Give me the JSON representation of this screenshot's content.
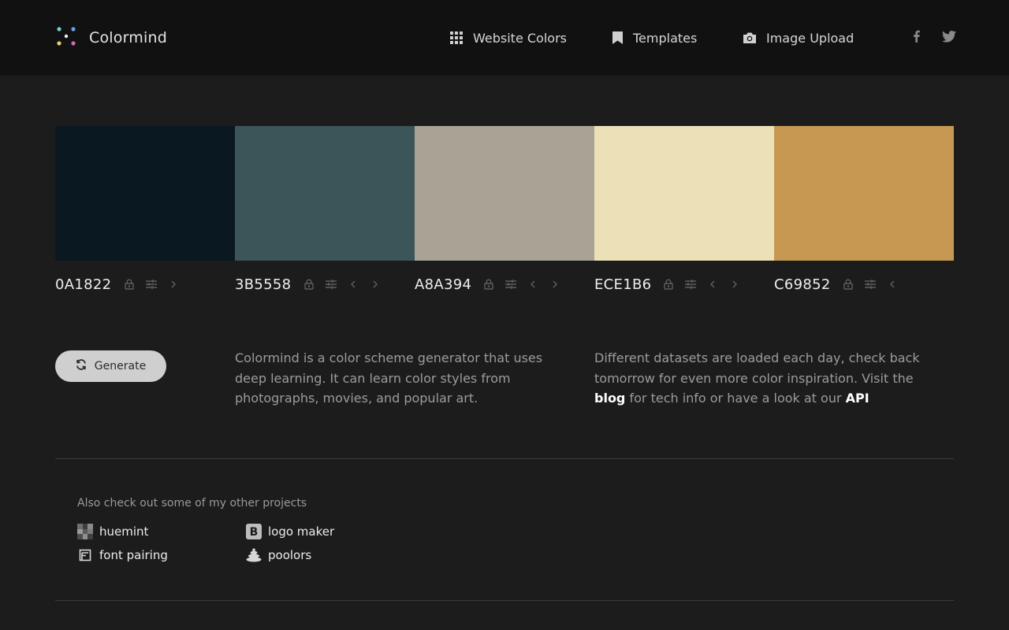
{
  "header": {
    "brand": "Colormind",
    "nav": [
      {
        "label": "Website Colors",
        "icon": "grid-icon"
      },
      {
        "label": "Templates",
        "icon": "bookmark-icon"
      },
      {
        "label": "Image Upload",
        "icon": "camera-icon"
      }
    ],
    "social": [
      "facebook-icon",
      "twitter-icon"
    ]
  },
  "palette": [
    {
      "hex": "0A1822",
      "color": "#0A1822"
    },
    {
      "hex": "3B5558",
      "color": "#3B5558"
    },
    {
      "hex": "A8A394",
      "color": "#A8A394"
    },
    {
      "hex": "ECE1B6",
      "color": "#ECE1B6"
    },
    {
      "hex": "C69852",
      "color": "#C69852"
    }
  ],
  "generate": {
    "label": "Generate"
  },
  "description": {
    "left": "Colormind is a color scheme generator that uses deep learning. It can learn color styles from photographs, movies, and popular art.",
    "right_part1": "Different datasets are loaded each day, check back tomorrow for even more color inspiration. Visit the",
    "right_link1": "blog",
    "right_part2": "for tech info or have a look at our",
    "right_link2": "API"
  },
  "projects": {
    "title": "Also check out some of my other projects",
    "items": [
      {
        "label": "huemint"
      },
      {
        "label": "logo maker"
      },
      {
        "label": "font pairing"
      },
      {
        "label": "poolors"
      }
    ]
  },
  "colors": {
    "background": "#1c1c1c",
    "header_bg": "#111111",
    "button_bg": "#cfcfcf"
  }
}
